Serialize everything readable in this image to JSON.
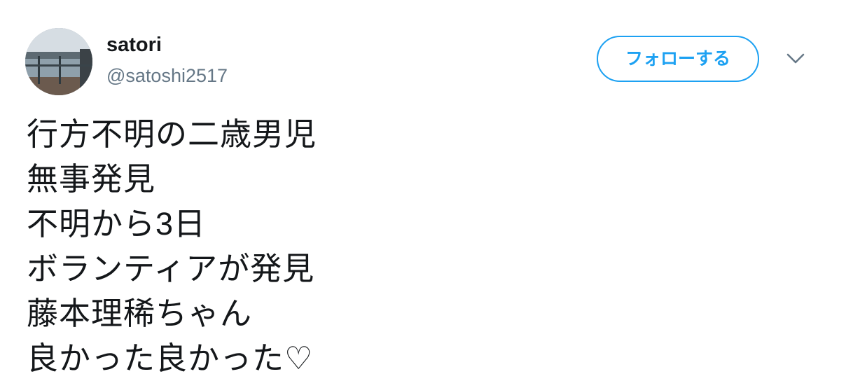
{
  "user": {
    "name": "satori",
    "handle": "@satoshi2517",
    "avatar_icon": "balcony-photo-avatar"
  },
  "actions": {
    "follow_label": "フォローする",
    "more_icon": "chevron-down-icon"
  },
  "tweet": {
    "lines": [
      "行方不明の二歳男児",
      "無事発見",
      "不明から3日",
      "ボランティアが発見",
      "藤本理稀ちゃん",
      "良かった良かった♡"
    ]
  },
  "colors": {
    "accent": "#1da1f2",
    "text": "#14171a",
    "secondary_text": "#657786",
    "background": "#ffffff"
  }
}
